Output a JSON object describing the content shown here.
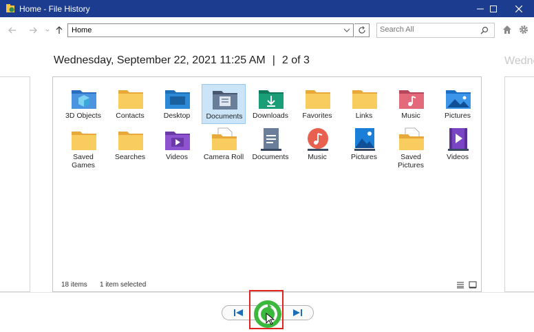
{
  "window": {
    "title": "Home - File History",
    "minimize_icon": "minimize-icon",
    "maximize_icon": "maximize-icon",
    "close_icon": "close-icon"
  },
  "toolbar": {
    "address": "Home",
    "search_placeholder": "Search All"
  },
  "header": {
    "date": "Wednesday, September 22, 2021 11:25 AM",
    "separator": "|",
    "position": "2 of 3",
    "next_date_peek": "Wedne"
  },
  "items": [
    {
      "label": "3D Objects",
      "icon": "3d-objects-folder"
    },
    {
      "label": "Contacts",
      "icon": "yellow-folder"
    },
    {
      "label": "Desktop",
      "icon": "desktop-folder"
    },
    {
      "label": "Documents",
      "icon": "documents-folder",
      "selected": true
    },
    {
      "label": "Downloads",
      "icon": "downloads-folder"
    },
    {
      "label": "Favorites",
      "icon": "yellow-folder"
    },
    {
      "label": "Links",
      "icon": "yellow-folder"
    },
    {
      "label": "Music",
      "icon": "music-folder"
    },
    {
      "label": "Pictures",
      "icon": "pictures-folder"
    },
    {
      "label": "Saved Games",
      "icon": "yellow-folder"
    },
    {
      "label": "Searches",
      "icon": "yellow-folder"
    },
    {
      "label": "Videos",
      "icon": "videos-folder"
    },
    {
      "label": "Camera Roll",
      "icon": "folder-with-document"
    },
    {
      "label": "Documents",
      "icon": "documents-library"
    },
    {
      "label": "Music",
      "icon": "music-library"
    },
    {
      "label": "Pictures",
      "icon": "pictures-library"
    },
    {
      "label": "Saved Pictures",
      "icon": "folder-with-document"
    },
    {
      "label": "Videos",
      "icon": "videos-library"
    }
  ],
  "status": {
    "count": "18 items",
    "selection": "1 item selected"
  },
  "colors": {
    "titlebar": "#1c3d8f",
    "restore_green": "#3cb83c",
    "highlight_red": "#e0211c",
    "selection_bg": "#cce4f7"
  }
}
